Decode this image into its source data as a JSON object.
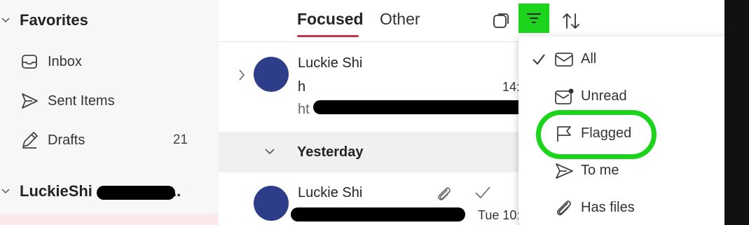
{
  "nav": {
    "favorites_title": "Favorites",
    "items": [
      {
        "label": "Inbox",
        "icon": "inbox-icon",
        "count": ""
      },
      {
        "label": "Sent Items",
        "icon": "send-icon",
        "count": ""
      },
      {
        "label": "Drafts",
        "icon": "drafts-icon",
        "count": "21"
      }
    ],
    "account_title": "LuckieShi",
    "account_suffix": ".."
  },
  "tabs": {
    "focused": "Focused",
    "other": "Other"
  },
  "messages": [
    {
      "sender": "Luckie Shi",
      "line2": "h",
      "preview": "ht",
      "time": "14:"
    },
    {
      "sender": "Luckie Shi",
      "time": "Tue 10:"
    }
  ],
  "group_header": "Yesterday",
  "filter_menu": {
    "items": [
      {
        "label": "All",
        "icon": "mail-icon",
        "checked": true
      },
      {
        "label": "Unread",
        "icon": "unread-mail-icon",
        "checked": false
      },
      {
        "label": "Flagged",
        "icon": "flag-icon",
        "checked": false
      },
      {
        "label": "To me",
        "icon": "send-icon",
        "checked": false
      },
      {
        "label": "Has files",
        "icon": "paperclip-icon",
        "checked": false
      }
    ]
  },
  "colors": {
    "accent_underline": "#c4314b",
    "avatar": "#2d3d8a",
    "highlight": "#1dd41d"
  }
}
